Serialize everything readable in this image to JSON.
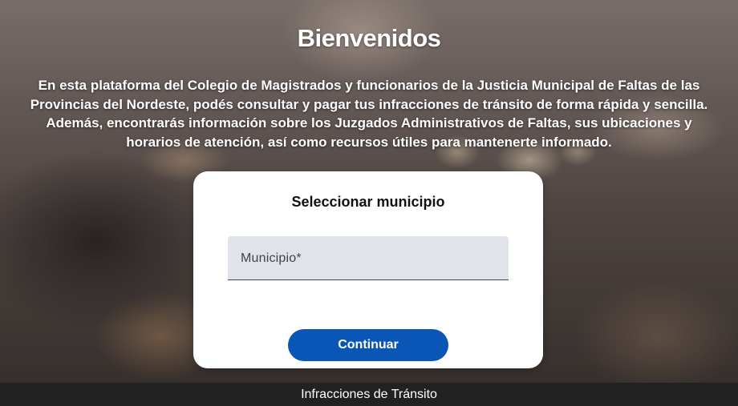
{
  "hero": {
    "title": "Bienvenidos",
    "intro_lines": [
      "En esta plataforma del Colegio de Magistrados y funcionarios de la Justicia Municipal de Faltas de las",
      "Provincias del Nordeste, podés consultar y pagar tus infracciones de tránsito de forma rápida y sencilla.",
      "Además, encontrarás información sobre los Juzgados Administrativos de Faltas, sus ubicaciones y",
      "horarios de atención, así como recursos útiles para mantenerte informado."
    ]
  },
  "card": {
    "title": "Seleccionar municipio",
    "municipio_field": {
      "label": "Municipio*",
      "value": ""
    },
    "continue_label": "Continuar"
  },
  "footer": {
    "text": "Infracciones de Tránsito"
  },
  "colors": {
    "primary_button": "#0a56b6",
    "field_background": "#e1e3ea",
    "footer_background": "#212121"
  }
}
